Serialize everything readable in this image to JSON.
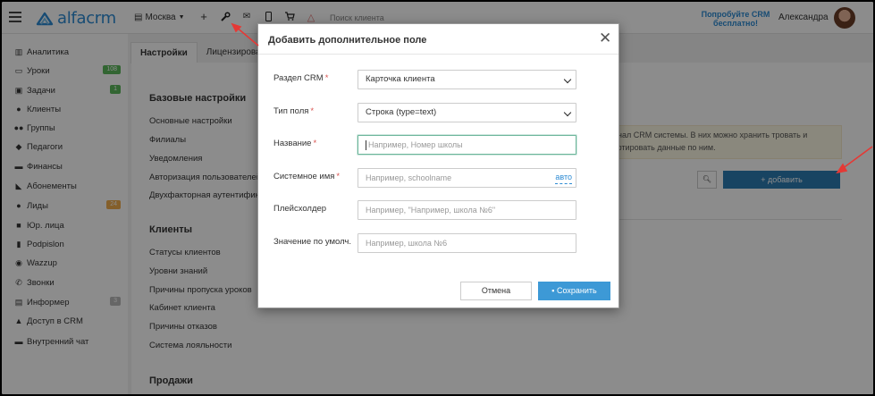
{
  "header": {
    "logo_text": "alfacrm",
    "city": "Москва",
    "search_placeholder": "Поиск клиента",
    "try_free": "Попробуйте CRM бесплатно!",
    "user_name": "Александра"
  },
  "sidebar": {
    "items": [
      {
        "label": "Аналитика",
        "icon": "chart-icon"
      },
      {
        "label": "Уроки",
        "icon": "calendar-icon",
        "badge": "108",
        "badge_color": "#5cb85c"
      },
      {
        "label": "Задачи",
        "icon": "tasks-icon",
        "badge": "1",
        "badge_color": "#5cb85c"
      },
      {
        "label": "Клиенты",
        "icon": "user-icon"
      },
      {
        "label": "Группы",
        "icon": "users-icon"
      },
      {
        "label": "Педагоги",
        "icon": "graduation-cap-icon"
      },
      {
        "label": "Финансы",
        "icon": "money-icon"
      },
      {
        "label": "Абонементы",
        "icon": "tag-icon"
      },
      {
        "label": "Лиды",
        "icon": "lead-icon",
        "badge": "24",
        "badge_color": "#f0ad4e"
      },
      {
        "label": "Юр. лица",
        "icon": "briefcase-icon"
      },
      {
        "label": "Podpislon",
        "icon": "document-icon"
      },
      {
        "label": "Wazzup",
        "icon": "whatsapp-icon"
      },
      {
        "label": "Звонки",
        "icon": "phone-icon"
      },
      {
        "label": "Информер",
        "icon": "informer-icon",
        "badge": "3",
        "badge_color": "#bbbbbb"
      },
      {
        "label": "Доступ в CRM",
        "icon": "lock-icon"
      },
      {
        "label": "Внутренний чат",
        "icon": "chat-icon"
      }
    ]
  },
  "settings": {
    "tabs": [
      "Настройки",
      "Лицензирован"
    ],
    "base_title": "Базовые настройки",
    "base_links": [
      "Основные настройки",
      "Филиалы",
      "Уведомления",
      "Авторизация пользователей",
      "Двухфакторная аутентификация"
    ],
    "clients_title": "Клиенты",
    "clients_links": [
      "Статусы клиентов",
      "Уровни знаний",
      "Причины пропуска уроков",
      "Кабинет клиента",
      "Причины отказов",
      "Система лояльности"
    ],
    "sales_title": "Продажи"
  },
  "right_panel": {
    "notice_text": "ионал CRM системы. В них можно хранить тровать и сортировать данные по ним.",
    "add_button": "+ добавить"
  },
  "modal": {
    "title": "Добавить дополнительное поле",
    "fields": {
      "section_label": "Раздел CRM",
      "section_value": "Карточка клиента",
      "type_label": "Тип поля",
      "type_value": "Строка (type=text)",
      "name_label": "Название",
      "name_placeholder": "Например, Номер школы",
      "system_label": "Системное имя",
      "system_placeholder": "Например, schoolname",
      "auto_link": "авто",
      "placeholder_label": "Плейсхолдер",
      "placeholder_placeholder": "Например, \"Например, школа №6\"",
      "default_label": "Значение по умолч.",
      "default_placeholder": "Например, школа №6"
    },
    "required_mark": "*",
    "cancel": "Отмена",
    "save": "Сохранить"
  },
  "colors": {
    "brand": "#2c8ad3",
    "primary_button": "#3d99d6",
    "add_button": "#2c7cb3",
    "annotation_arrow": "#e53935",
    "required": "#d9534f"
  }
}
